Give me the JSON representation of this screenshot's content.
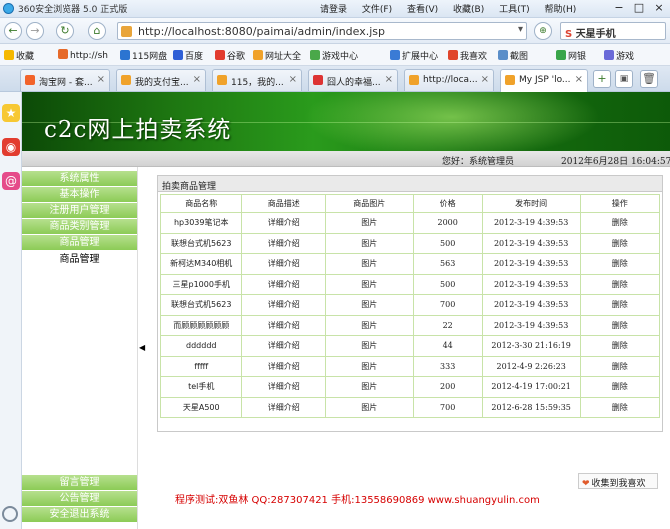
{
  "browser": {
    "title": "360安全浏览器 5.0 正式版",
    "login": "请登录",
    "menus": [
      "文件(F)",
      "查看(V)",
      "收藏(B)",
      "工具(T)",
      "帮助(H)"
    ],
    "address": "http://localhost:8080/paimai/admin/index.jsp",
    "search_engine": "天星手机",
    "favorites": [
      "收藏",
      "http://sh",
      "115网盘",
      "百度",
      "谷歌",
      "网址大全",
      "游戏中心",
      "扩展中心",
      "我喜欢",
      "截图",
      "网银",
      "游戏"
    ],
    "tabs": [
      "淘宝网 - 套...",
      "我的支付宝...",
      "115，我的...",
      "囧人的幸福...",
      "http://loca...",
      "My JSP 'lo..."
    ]
  },
  "page": {
    "banner_title": "c2c网上拍卖系统",
    "greeting": "您好：系统管理员",
    "date": "2012年6月28日  16:04:57",
    "menu_top": [
      "系统属性",
      "基本操作",
      "注册用户管理",
      "商品类别管理",
      "商品管理"
    ],
    "menu_sub": "商品管理",
    "menu_bottom": [
      "留言管理",
      "公告管理",
      "安全退出系统"
    ],
    "panel_title": "拍卖商品管理",
    "table": {
      "headers": [
        "商品名称",
        "商品描述",
        "商品图片",
        "价格",
        "发布时间",
        "操作"
      ],
      "rows": [
        [
          "hp3039笔记本",
          "详细介绍",
          "图片",
          "2000",
          "2012-3-19 4:39:53",
          "删除"
        ],
        [
          "联想台式机5623",
          "详细介绍",
          "图片",
          "500",
          "2012-3-19 4:39:53",
          "删除"
        ],
        [
          "新柯达M340相机",
          "详细介绍",
          "图片",
          "563",
          "2012-3-19 4:39:53",
          "删除"
        ],
        [
          "三星p1000手机",
          "详细介绍",
          "图片",
          "500",
          "2012-3-19 4:39:53",
          "删除"
        ],
        [
          "联想台式机5623",
          "详细介绍",
          "图片",
          "700",
          "2012-3-19 4:39:53",
          "删除"
        ],
        [
          "而顾顾顾顾顾顾",
          "详细介绍",
          "图片",
          "22",
          "2012-3-19 4:39:53",
          "删除"
        ],
        [
          "dddddd",
          "详细介绍",
          "图片",
          "44",
          "2012-3-30 21:16:19",
          "删除"
        ],
        [
          "fffff",
          "详细介绍",
          "图片",
          "333",
          "2012-4-9 2:26:23",
          "删除"
        ],
        [
          "tel手机",
          "详细介绍",
          "图片",
          "200",
          "2012-4-19 17:00:21",
          "删除"
        ],
        [
          "天星A500",
          "详细介绍",
          "图片",
          "700",
          "2012-6-28 15:59:35",
          "删除"
        ]
      ]
    },
    "collect_label": "收集到我喜欢",
    "credit": "程序测试:双鱼林 QQ:287307421 手机:13558690869 www.shuangyulin.com"
  }
}
